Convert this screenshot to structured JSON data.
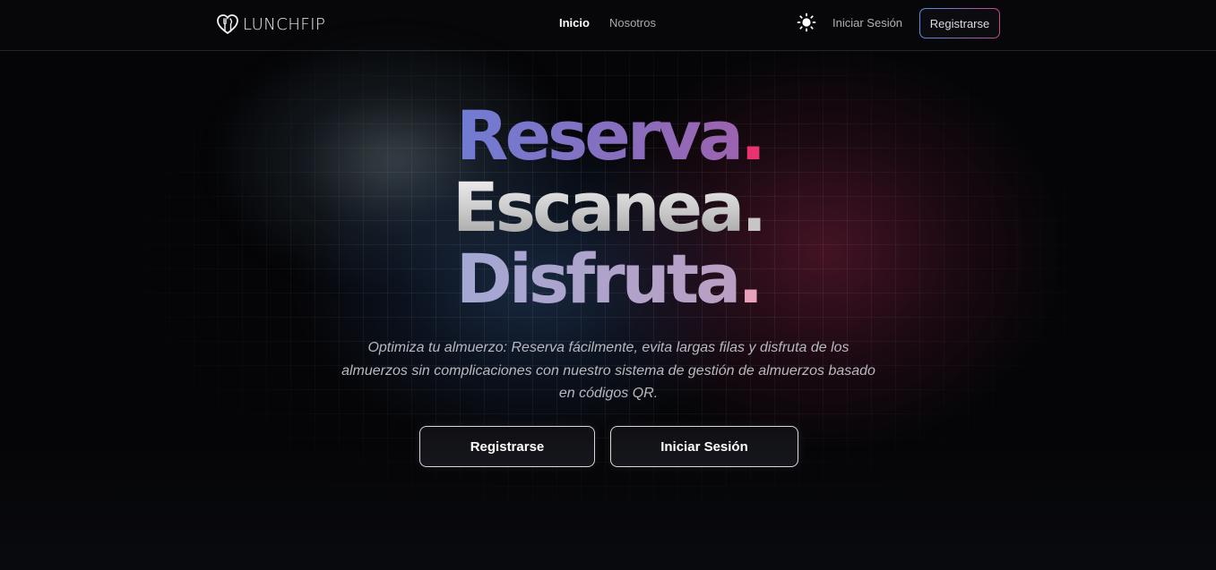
{
  "navbar": {
    "logo_text": "LUNCHFIP",
    "links": [
      {
        "label": "Inicio",
        "active": true
      },
      {
        "label": "Nosotros",
        "active": false
      }
    ],
    "theme_icon": "sun-icon",
    "login_label": "Iniciar Sesión",
    "register_label": "Registrarse"
  },
  "hero": {
    "line1": "Reserva",
    "line2": "Escanea",
    "line3": "Disfruta",
    "dot": ".",
    "subtitle": "Optimiza tu almuerzo: Reserva fácilmente, evita largas filas y disfruta de los almuerzos sin complicaciones con nuestro sistema de gestión de almuerzos basado en códigos QR.",
    "cta_register": "Registrarse",
    "cta_login": "Iniciar Sesión"
  },
  "colors": {
    "background": "#050507",
    "accent_blue": "#1f9cf0",
    "accent_pink": "#e8336f"
  }
}
